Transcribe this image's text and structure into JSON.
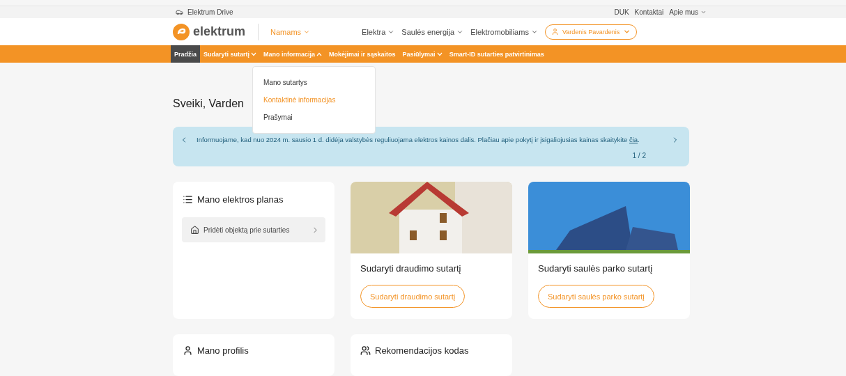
{
  "top_bar": {
    "brand": "Elektrum Drive",
    "links": [
      {
        "label": "DUK",
        "has_caret": false
      },
      {
        "label": "Kontaktai",
        "has_caret": false
      },
      {
        "label": "Apie mus",
        "has_caret": true
      }
    ]
  },
  "header": {
    "logo": "elektrum",
    "segment": "Namams",
    "nav": [
      "Elektra",
      "Saulės energija",
      "Elektromobiliams"
    ],
    "user": "Vardenis Pavardenis"
  },
  "main_nav": [
    {
      "label": "Pradžia",
      "selected": true,
      "has_caret": false
    },
    {
      "label": "Sudaryti sutartį",
      "selected": false,
      "has_caret": true,
      "expanded": false
    },
    {
      "label": "Mano informacija",
      "selected": false,
      "has_caret": true,
      "expanded": true
    },
    {
      "label": "Mokėjimai ir sąskaitos",
      "selected": false,
      "has_caret": false
    },
    {
      "label": "Pasiūlymai",
      "selected": false,
      "has_caret": true,
      "expanded": false
    },
    {
      "label": "Smart-ID sutarties patvirtinimas",
      "selected": false,
      "has_caret": false
    }
  ],
  "dropdown": [
    {
      "label": "Mano sutartys",
      "selected": false
    },
    {
      "label": "Kontaktinė informacijas",
      "selected": true
    },
    {
      "label": "Prašymai",
      "selected": false
    }
  ],
  "greeting": "Sveiki, Varden",
  "banner": {
    "text": "Informuojame, kad nuo 2024 m. sausio 1 d. didėja valstybės reguliuojama elektros kainos dalis. Plačiau apie pokytį ir įsigaliojusias kainas skaitykite ",
    "link": "čia",
    "after": ".",
    "pager": "1 / 2"
  },
  "cards": [
    {
      "kind": "plan",
      "title": "Mano elektros planas",
      "item": "Pridėti objektą prie sutarties"
    },
    {
      "kind": "insurance",
      "title": "Sudaryti draudimo sutartį",
      "button": "Sudaryti draudimo sutartį"
    },
    {
      "kind": "solar",
      "title": "Sudaryti saulės parko sutartį",
      "button": "Sudaryti saulės parko sutartį"
    },
    {
      "kind": "profile",
      "title": "Mano profilis"
    },
    {
      "kind": "referral",
      "title": "Rekomendacijos kodas"
    }
  ]
}
